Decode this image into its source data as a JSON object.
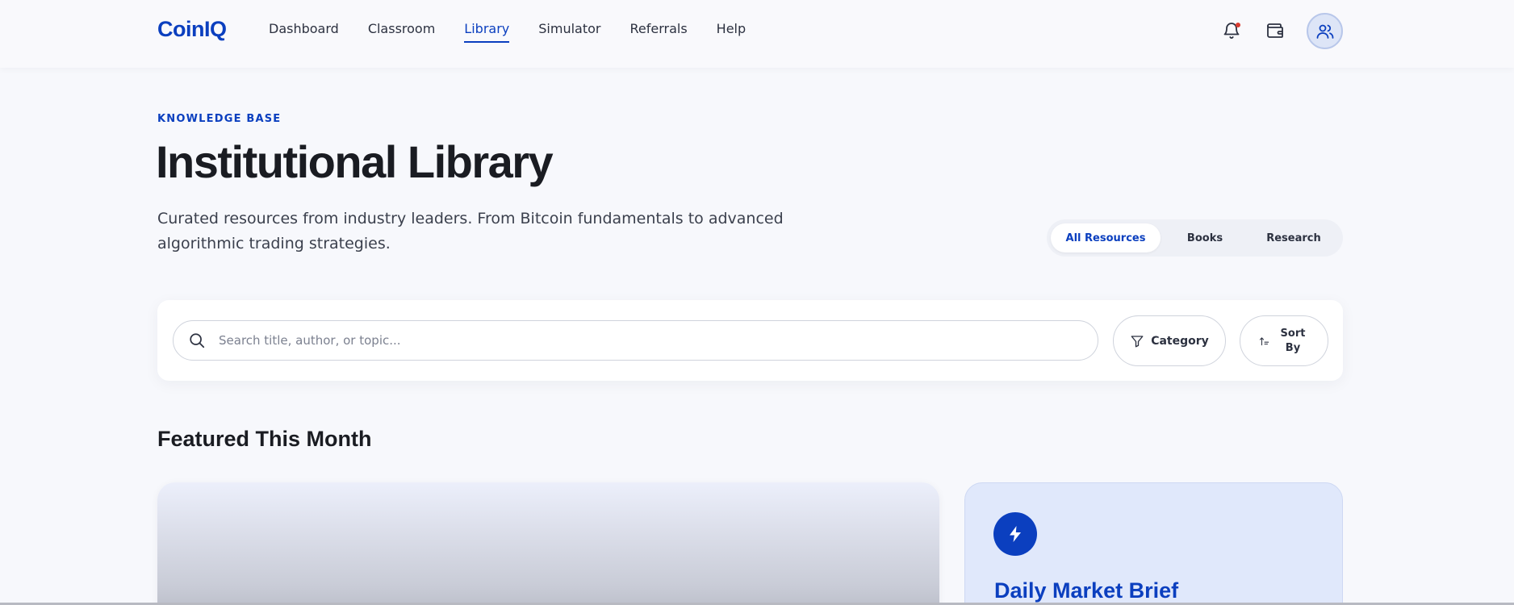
{
  "header": {
    "logo": "CoinIQ",
    "nav": [
      {
        "label": "Dashboard",
        "active": false
      },
      {
        "label": "Classroom",
        "active": false
      },
      {
        "label": "Library",
        "active": true
      },
      {
        "label": "Simulator",
        "active": false
      },
      {
        "label": "Referrals",
        "active": false
      },
      {
        "label": "Help",
        "active": false
      }
    ],
    "icons": [
      "bell-icon",
      "wallet-icon",
      "users-icon"
    ],
    "notification_dot_color": "#d93b2f"
  },
  "hero": {
    "eyebrow": "KNOWLEDGE BASE",
    "title": "Institutional Library",
    "subtitle": "Curated resources from industry leaders. From Bitcoin fundamentals to advanced algorithmic trading strategies."
  },
  "filters": {
    "segments": [
      "All Resources",
      "Books",
      "Research"
    ],
    "active_segment": "All Resources"
  },
  "search": {
    "placeholder": "Search title, author, or topic...",
    "value": "",
    "category_label": "Category",
    "sort_label": "Sort By"
  },
  "featured": {
    "section_title": "Featured This Month",
    "brief_title": "Daily Market Brief"
  },
  "colors": {
    "accent": "#0b3fbf",
    "background": "#f7f8fc",
    "brief_card": "#e0e8fb"
  }
}
